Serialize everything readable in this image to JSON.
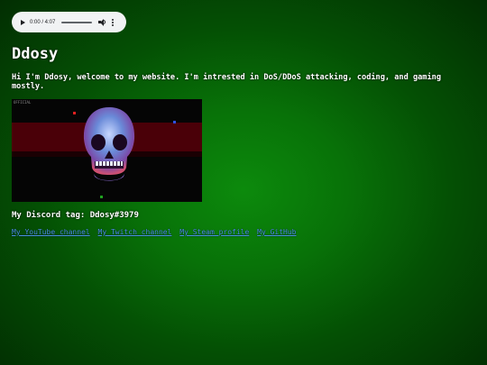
{
  "audio": {
    "time": "0:00 / 4:07",
    "icons": [
      "play-icon",
      "volume-icon",
      "more-vert-icon"
    ]
  },
  "page": {
    "title": "Ddosy",
    "intro": "Hi I'm Ddosy, welcome to my website. I'm intrested in DoS/DDoS attacking, coding, and gaming mostly.",
    "hero_image": {
      "corner_text": "OFFICIAL",
      "subject": "skull-image"
    },
    "discord": "My Discord tag: Ddosy#3979",
    "links": [
      "My YouTube channel",
      "My Twitch channel",
      "My Steam profile",
      "My GitHub"
    ]
  },
  "colors": {
    "background": "#087208",
    "link": "#4a90e2",
    "text": "#ffffff",
    "band": "#4a0008"
  }
}
